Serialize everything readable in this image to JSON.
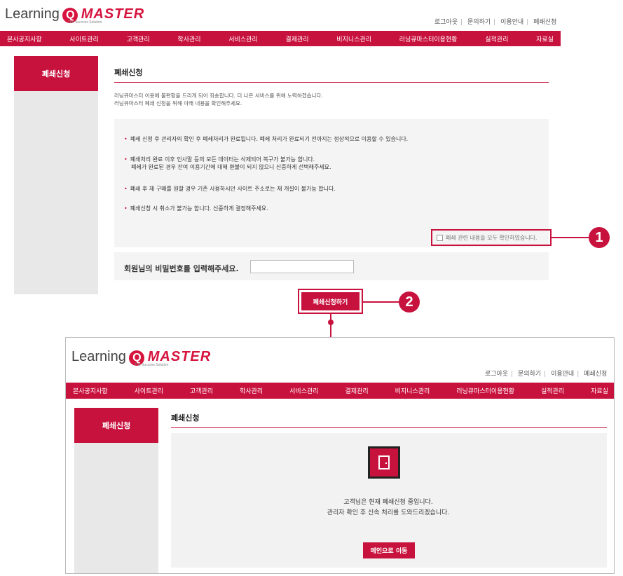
{
  "logo": {
    "word": "Learning",
    "q": "Q",
    "master": "MASTER",
    "tagline": "The Success Solution"
  },
  "top_links": [
    "로그아웃",
    "문의하기",
    "이용안내",
    "폐쇄신청"
  ],
  "nav": [
    "본사공지사항",
    "사이트관리",
    "고객관리",
    "학사관리",
    "서비스관리",
    "결제관리",
    "비지니스관리",
    "러닝큐마스터이용현황",
    "실적관리",
    "자료실"
  ],
  "sidebar_title": "폐쇄신청",
  "page_title": "폐쇄신청",
  "intro": [
    "러닝큐마스터 이용에 불편함을 드리게 되어 죄송합니다. 더 나은 서비스를 위해 노력하겠습니다.",
    "러닝큐마스터 폐쇄 신청을 위해 아래 내용을 확인해주세요."
  ],
  "notices": [
    [
      "폐쇄 신청 후 관리자의 확인 후 폐쇄처리가 완료됩니다. 폐쇄 처리가 완료되기 전까지는 정상적으로 이용할 수 있습니다."
    ],
    [
      "폐쇄처리 완료 이후 인사말 등의 모든 데이터는 삭제되어 복구가 불가능 합니다.",
      "폐쇄가 완료된 경우 잔여 이용기간에 대해 환불이 되지 않으니 신중하게 선택해주세요."
    ],
    [
      "폐쇄 후 재 구매를 원할 경우 기존 사용하시던 사이트 주소로는 재 개설이 불가능 합니다."
    ],
    [
      "폐쇄신청 시 취소가 불가능 합니다. 신중하게 결정해주세요."
    ]
  ],
  "agree_label": "폐쇄 관련 내용을 모두 확인하였습니다.",
  "password_label": "회원님의 비밀번호를 입력해주세요.",
  "password_value": "",
  "submit_label": "폐쇄신청하기",
  "callouts": [
    "1",
    "2"
  ],
  "result": {
    "title": "폐쇄신청",
    "line1": "고객님은 현재 폐쇄신청 중입니다.",
    "line2": "관리자 확인 후 신속 처리를 도와드리겠습니다.",
    "main_button": "메인으로 이동"
  },
  "colors": {
    "brand": "#c8123e",
    "sidebar": "#e8e8e8",
    "panel": "#f4f4f4"
  }
}
